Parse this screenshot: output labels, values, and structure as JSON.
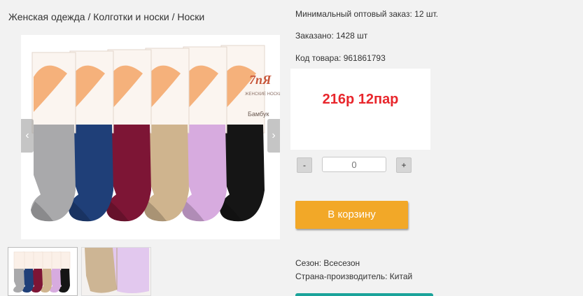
{
  "breadcrumb": "Женская одежда / Колготки и носки / Носки",
  "gallery": {
    "prev_arrow": "‹",
    "next_arrow": "›",
    "package_brand": "7пЯ",
    "package_subtitle": "ЖЕНСКИЕ НОСКИ",
    "package_material": "Бамбук"
  },
  "product": {
    "min_order": "Минимальный оптовый заказ: 12 шт.",
    "ordered": "Заказано: 1428 шт",
    "code": "Код товара: 961861793",
    "price": "216р 12пар"
  },
  "quantity": {
    "minus": "-",
    "value": "0",
    "plus": "+"
  },
  "cart_button": "В корзину",
  "details": {
    "season": "Сезон: Всесезон",
    "country": "Страна-производитель: Китай"
  },
  "colors": {
    "price": "#e8262c",
    "cart_button": "#f2a828",
    "accent_bar": "#1aa39a"
  },
  "sock_colors": [
    "#a9a9ab",
    "#1f3f78",
    "#7d1535",
    "#cfb48e",
    "#d7abdf",
    "#151515"
  ]
}
